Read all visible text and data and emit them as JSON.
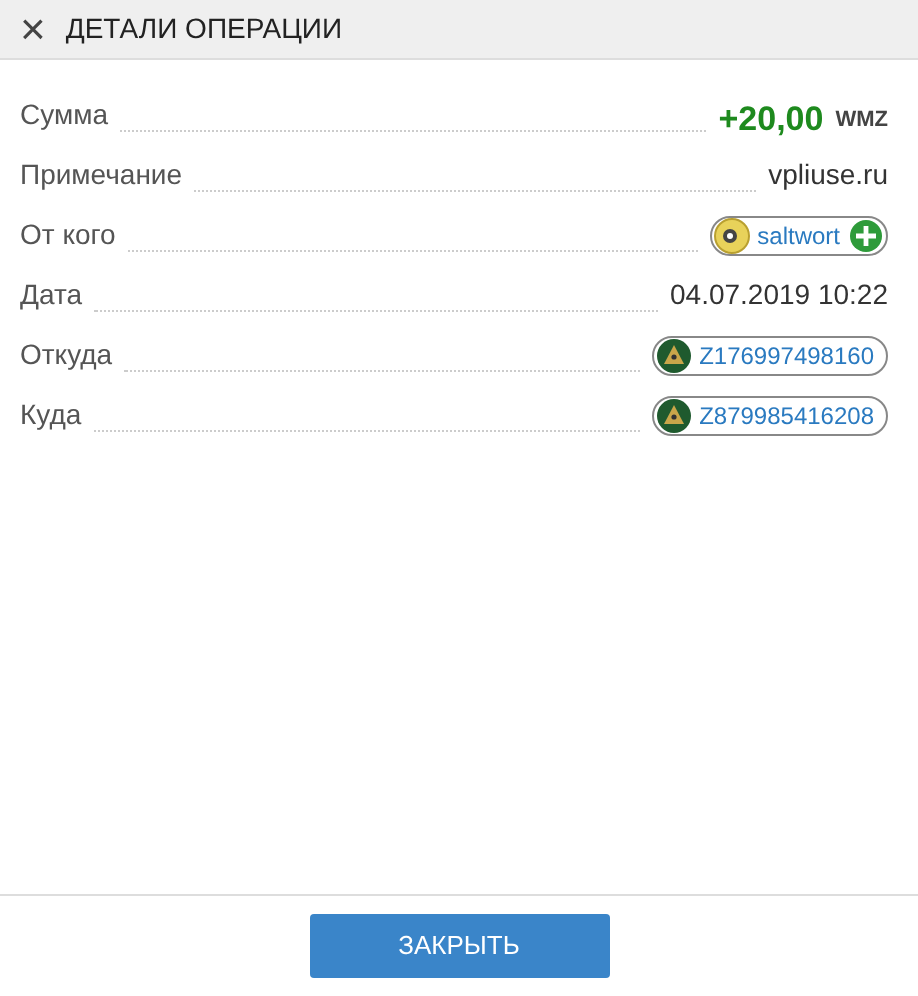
{
  "header": {
    "close_icon": "×",
    "title": "ДЕТАЛИ ОПЕРАЦИИ"
  },
  "details": [
    {
      "kind": "amount",
      "label": "Сумма",
      "value": "+20,00",
      "currency": "WMZ"
    },
    {
      "kind": "text",
      "label": "Примечание",
      "value": "vpliuse.ru"
    },
    {
      "kind": "contact",
      "label": "От кого",
      "value": "saltwort"
    },
    {
      "kind": "text",
      "label": "Дата",
      "value": "04.07.2019 10:22"
    },
    {
      "kind": "wallet",
      "label": "Откуда",
      "value": "Z176997498160"
    },
    {
      "kind": "wallet",
      "label": "Куда",
      "value": "Z879985416208"
    }
  ],
  "buttons": [
    "ЗАКРЫТЬ"
  ]
}
